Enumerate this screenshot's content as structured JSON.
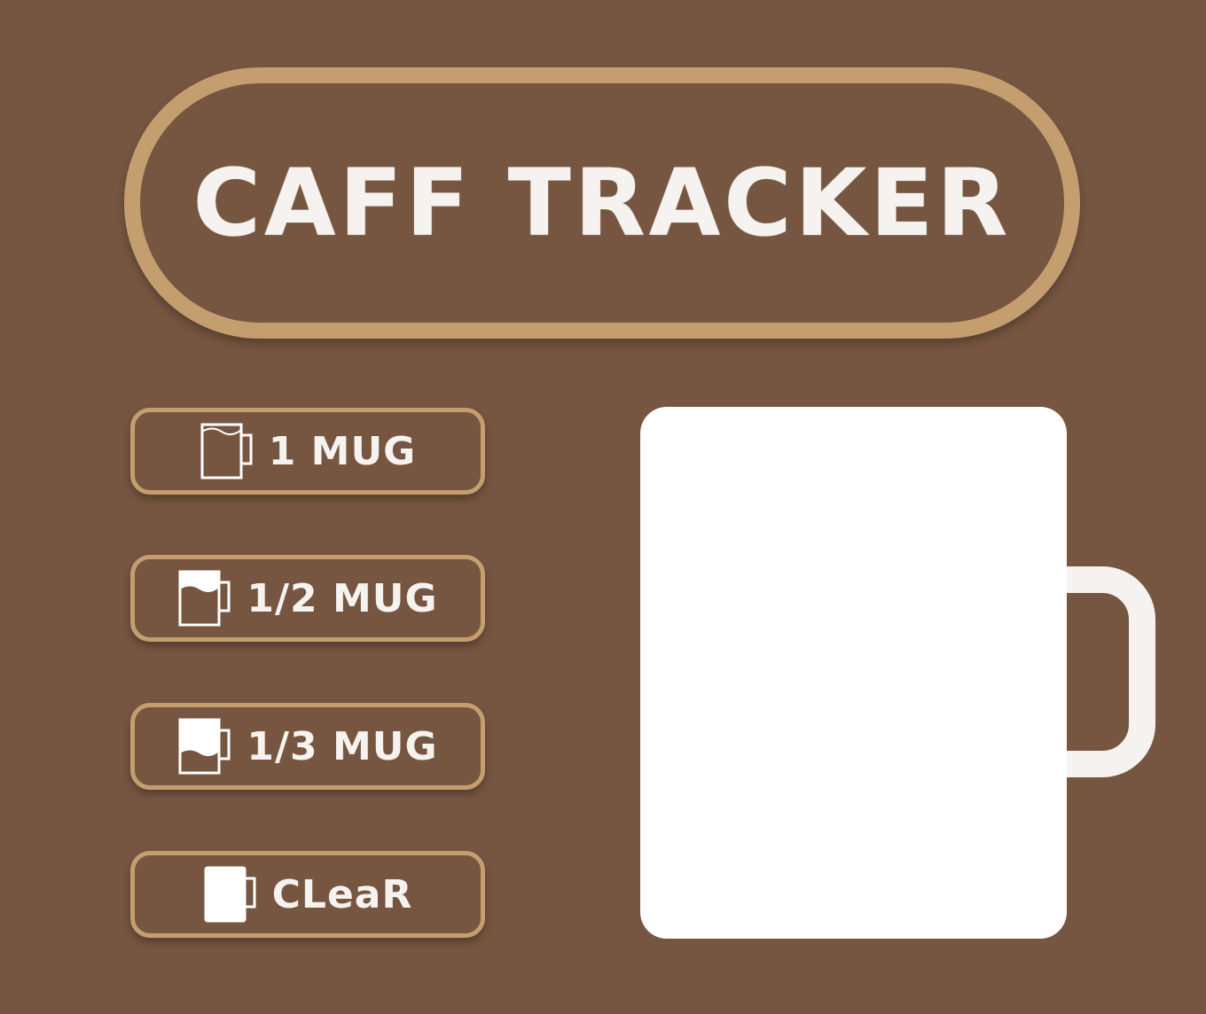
{
  "app": {
    "title": "CAFF TRACKER"
  },
  "buttons": [
    {
      "label": "1 MUG",
      "icon": "full-mug-icon",
      "fill_fraction": 1.0
    },
    {
      "label": "1/2 MUG",
      "icon": "half-mug-icon",
      "fill_fraction": 0.5
    },
    {
      "label": "1/3 MUG",
      "icon": "third-mug-icon",
      "fill_fraction": 0.333
    },
    {
      "label": "CLeaR",
      "icon": "empty-mug-icon",
      "fill_fraction": 0
    }
  ],
  "mug": {
    "fill_fraction": 0
  },
  "colors": {
    "background": "#765641",
    "accent": "#c49e6f",
    "text": "#f5f2ef",
    "mug": "#ffffff"
  }
}
